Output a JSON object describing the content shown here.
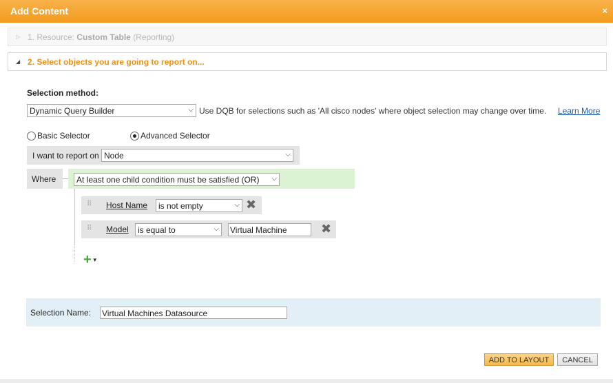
{
  "dialog": {
    "title": "Add Content",
    "close_glyph": "×"
  },
  "steps": [
    {
      "number_label": "1. Resource:",
      "name": "Custom Table",
      "suffix": "(Reporting)",
      "state": "collapsed"
    },
    {
      "label": "2. Select objects you are going to report on...",
      "state": "expanded"
    }
  ],
  "selection_method": {
    "label": "Selection method:",
    "value": "Dynamic Query Builder",
    "hint": "Use DQB for selections such as 'All cisco nodes' where object selection may change over time.",
    "learn_more": "Learn More"
  },
  "selector_mode": {
    "options": [
      {
        "label": "Basic Selector",
        "selected": false
      },
      {
        "label": "Advanced Selector",
        "selected": true
      }
    ]
  },
  "report_on": {
    "label": "I want to report on",
    "value": "Node"
  },
  "where": {
    "label": "Where",
    "group_value": "At least one child condition must be satisfied (OR)",
    "conditions": [
      {
        "field": "Host Name",
        "operator": "is not empty",
        "value": ""
      },
      {
        "field": "Model",
        "operator": "is equal to",
        "value": "Virtual Machine"
      }
    ],
    "remove_glyph": "✖",
    "add_glyph": "+"
  },
  "selection_name": {
    "label": "Selection Name:",
    "value": "Virtual Machines Datasource"
  },
  "buttons": {
    "add_to_layout": "ADD TO LAYOUT",
    "cancel": "CANCEL"
  },
  "colors": {
    "title_bar": "#f39b1c",
    "step_active": "#f0900f",
    "where_bar": "#dbf3d2",
    "selection_panel": "#e3eff7",
    "link": "#1a5fa8"
  }
}
